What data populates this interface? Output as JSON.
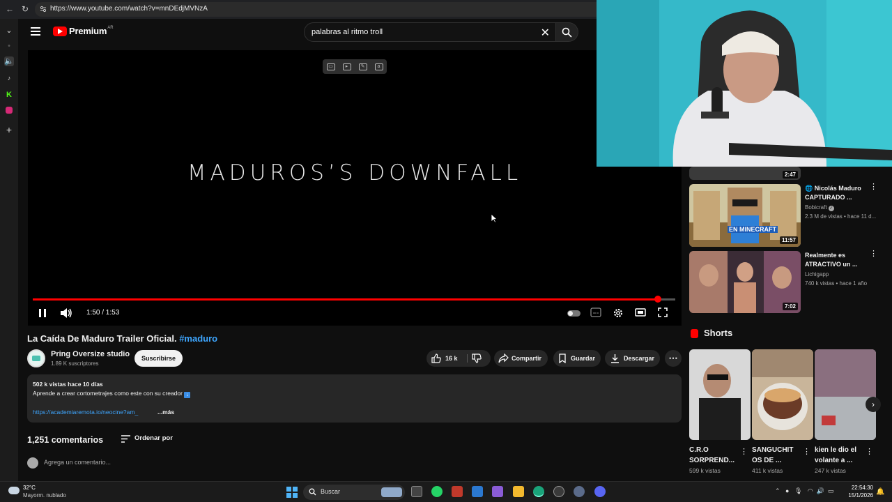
{
  "browser": {
    "url": "https://www.youtube.com/watch?v=mnDEdjMVNzA"
  },
  "header": {
    "logo_text": "Premium",
    "logo_region": "AR",
    "search_value": "palabras al ritmo troll"
  },
  "player": {
    "overlay_title": "MADUROS’S DOWNFALL",
    "time": "1:50 / 1:53",
    "progress": 0.973
  },
  "video": {
    "title": "La Caída De Maduro Trailer Oficial.",
    "hashtag": "#maduro",
    "channel": "Pring Oversize studio",
    "subscribers": "1.89 K suscriptores",
    "subscribe_label": "Suscribirse",
    "likes": "16 k",
    "share_label": "Compartir",
    "save_label": "Guardar",
    "download_label": "Descargar",
    "views_date": "502 k vistas  hace 10 días",
    "description_line": "Aprende a crear cortometrajes como este con su creador",
    "description_link": "https://academiaremota.io/neocine?am_",
    "more_label": "...más"
  },
  "comments": {
    "count": "1,251 comentarios",
    "sort_label": "Ordenar por",
    "placeholder": "Agrega un comentario..."
  },
  "sidebar": {
    "partial_duration": "2:47",
    "items": [
      {
        "title": "🌐 Nicolás Maduro CAPTURADO ...",
        "channel": "Bobicraft",
        "meta": "2.3 M de vistas • hace 11 d...",
        "duration": "11:57",
        "thumb_text": "EN MINECRAFT"
      },
      {
        "title": "Realmente es ATRACTIVO un ...",
        "channel": "Lichigapp",
        "meta": "740 k vistas • hace 1 año",
        "duration": "7:02"
      }
    ]
  },
  "shorts": {
    "label": "Shorts",
    "items": [
      {
        "title": "C.R.O SORPREND...",
        "views": "599 k vistas"
      },
      {
        "title": "SANGUCHIT OS DE ...",
        "views": "411 k vistas"
      },
      {
        "title": "kien le dio el volante a ...",
        "views": "247 k vistas"
      }
    ]
  },
  "taskbar": {
    "temp": "32°C",
    "weather": "Mayorm. nublado",
    "search_label": "Buscar",
    "time": "22:54:30",
    "date": "15/1/2026"
  },
  "colors": {
    "accent_red": "#ff0000",
    "link_blue": "#3ea6ff",
    "background": "#0f0f0f"
  }
}
